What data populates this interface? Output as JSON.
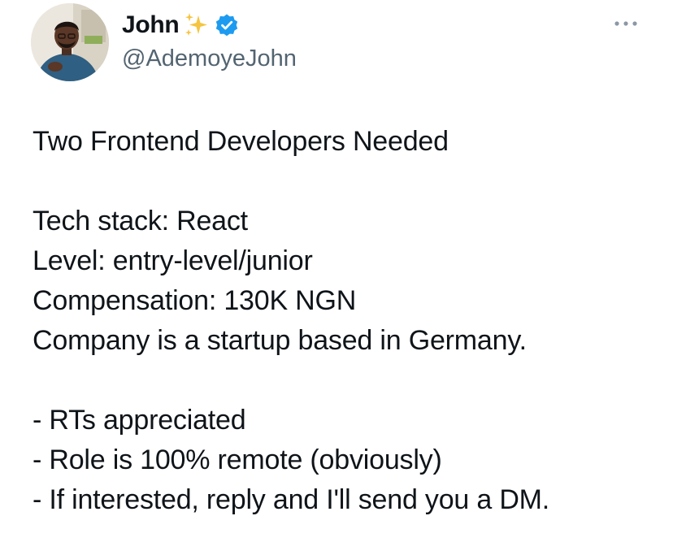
{
  "author": {
    "display_name": "John",
    "handle": "@AdemoyeJohn",
    "verified": true,
    "name_emoji": "sparkles-icon",
    "verified_color": "#1d9bf0"
  },
  "tweet": {
    "title_line": "Two Frontend Developers Needed",
    "details": [
      "Tech stack: React",
      "Level: entry-level/junior",
      "Compensation: 130K NGN",
      "Company is a startup based in Germany."
    ],
    "notes": [
      "- RTs appreciated",
      "- Role is 100% remote (obviously)",
      "- If interested, reply and I'll send you a DM."
    ]
  },
  "colors": {
    "text": "#0f1419",
    "secondary": "#536471",
    "accent": "#1d9bf0",
    "sparkle": "#f5c542"
  }
}
